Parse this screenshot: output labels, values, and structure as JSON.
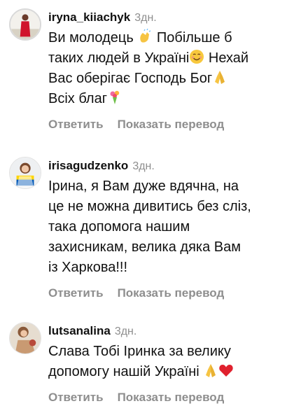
{
  "comments": [
    {
      "username": "iryna_kiiachyk",
      "time": "3дн.",
      "lines": [
        "Ви молодець",
        " Побільше б",
        "таких людей в Україні",
        " Нехай",
        "Вас оберігає Господь Бог",
        "Всіх благ"
      ],
      "reply_label": "Ответить",
      "translate_label": "Показать перевод",
      "emojis": [
        "clapping-hands",
        "smiling-face",
        "folded-hands",
        "bouquet"
      ]
    },
    {
      "username": "irisagudzenko",
      "time": "3дн.",
      "lines": [
        "Ірина, я Вам дуже вдячна, на",
        "це не можна дивитись без сліз,",
        "така допомога нашим",
        "захисникам, велика дяка Вам",
        "із Харкова!!!"
      ],
      "reply_label": "Ответить",
      "translate_label": "Показать перевод"
    },
    {
      "username": "lutsanalina",
      "time": "3дн.",
      "lines": [
        "Слава Тобі Іринка за велику",
        "допомогу нашій Україні "
      ],
      "reply_label": "Ответить",
      "translate_label": "Показать перевод",
      "emojis": [
        "folded-hands",
        "red-heart"
      ]
    }
  ]
}
